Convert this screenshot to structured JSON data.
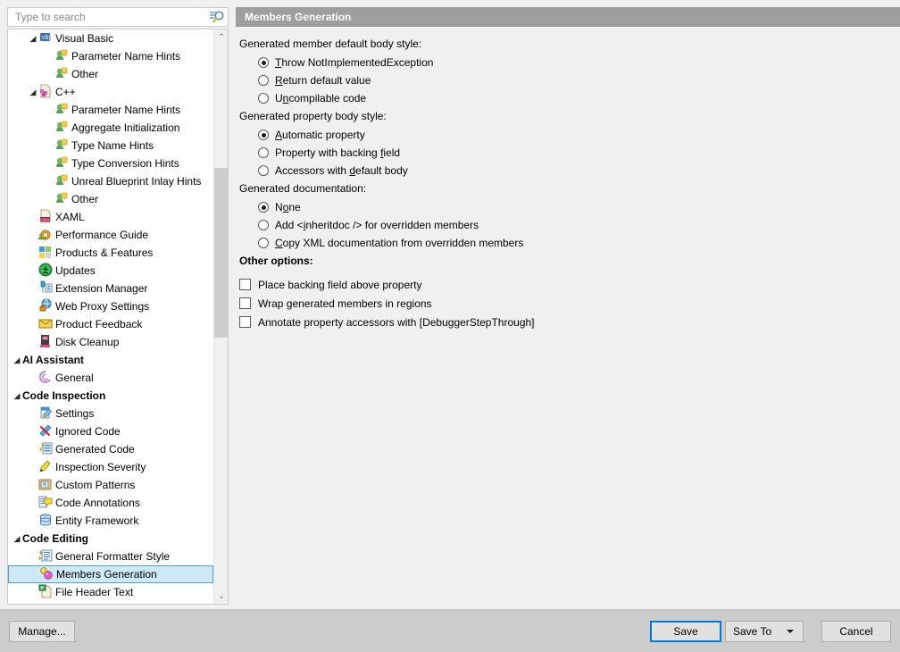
{
  "window": {
    "search": {
      "placeholder": "Type to search",
      "value": ""
    }
  },
  "tree": {
    "items": [
      {
        "label": "Visual Basic",
        "level": 1,
        "twisty": "◢",
        "icon": "visual-basic-icon",
        "group": false,
        "selected": false
      },
      {
        "label": "Parameter Name Hints",
        "level": 2,
        "twisty": "",
        "icon": "inlay-hints-icon",
        "group": false,
        "selected": false
      },
      {
        "label": "Other",
        "level": 2,
        "twisty": "",
        "icon": "inlay-hints-icon",
        "group": false,
        "selected": false
      },
      {
        "label": "C++",
        "level": 1,
        "twisty": "◢",
        "icon": "cpp-icon",
        "group": false,
        "selected": false
      },
      {
        "label": "Parameter Name Hints",
        "level": 2,
        "twisty": "",
        "icon": "inlay-hints-icon",
        "group": false,
        "selected": false
      },
      {
        "label": "Aggregate Initialization",
        "level": 2,
        "twisty": "",
        "icon": "inlay-hints-icon",
        "group": false,
        "selected": false
      },
      {
        "label": "Type Name Hints",
        "level": 2,
        "twisty": "",
        "icon": "inlay-hints-icon",
        "group": false,
        "selected": false
      },
      {
        "label": "Type Conversion Hints",
        "level": 2,
        "twisty": "",
        "icon": "inlay-hints-icon",
        "group": false,
        "selected": false
      },
      {
        "label": "Unreal Blueprint Inlay Hints",
        "level": 2,
        "twisty": "",
        "icon": "inlay-hints-icon",
        "group": false,
        "selected": false
      },
      {
        "label": "Other",
        "level": 2,
        "twisty": "",
        "icon": "inlay-hints-icon",
        "group": false,
        "selected": false
      },
      {
        "label": "XAML",
        "level": 1,
        "twisty": "",
        "icon": "xaml-icon",
        "group": false,
        "selected": false
      },
      {
        "label": "Performance Guide",
        "level": 1,
        "twisty": "",
        "icon": "snail-icon",
        "group": false,
        "selected": false
      },
      {
        "label": "Products & Features",
        "level": 1,
        "twisty": "",
        "icon": "products-features-icon",
        "group": false,
        "selected": false
      },
      {
        "label": "Updates",
        "level": 1,
        "twisty": "",
        "icon": "updates-icon",
        "group": false,
        "selected": false
      },
      {
        "label": "Extension Manager",
        "level": 1,
        "twisty": "",
        "icon": "extension-manager-icon",
        "group": false,
        "selected": false
      },
      {
        "label": "Web Proxy Settings",
        "level": 1,
        "twisty": "",
        "icon": "web-proxy-icon",
        "group": false,
        "selected": false
      },
      {
        "label": "Product Feedback",
        "level": 1,
        "twisty": "",
        "icon": "envelope-icon",
        "group": false,
        "selected": false
      },
      {
        "label": "Disk Cleanup",
        "level": 1,
        "twisty": "",
        "icon": "disk-cleanup-icon",
        "group": false,
        "selected": false
      },
      {
        "label": "AI Assistant",
        "level": 0,
        "twisty": "◢",
        "icon": "",
        "group": true,
        "selected": false
      },
      {
        "label": "General",
        "level": 1,
        "twisty": "",
        "icon": "ai-general-icon",
        "group": false,
        "selected": false
      },
      {
        "label": "Code Inspection",
        "level": 0,
        "twisty": "◢",
        "icon": "",
        "group": true,
        "selected": false
      },
      {
        "label": "Settings",
        "level": 1,
        "twisty": "",
        "icon": "settings-icon",
        "group": false,
        "selected": false
      },
      {
        "label": "Ignored Code",
        "level": 1,
        "twisty": "",
        "icon": "ignored-code-icon",
        "group": false,
        "selected": false
      },
      {
        "label": "Generated Code",
        "level": 1,
        "twisty": "",
        "icon": "generated-code-icon",
        "group": false,
        "selected": false
      },
      {
        "label": "Inspection Severity",
        "level": 1,
        "twisty": "",
        "icon": "inspection-severity-icon",
        "group": false,
        "selected": false
      },
      {
        "label": "Custom Patterns",
        "level": 1,
        "twisty": "",
        "icon": "custom-patterns-icon",
        "group": false,
        "selected": false
      },
      {
        "label": "Code Annotations",
        "level": 1,
        "twisty": "",
        "icon": "code-annotations-icon",
        "group": false,
        "selected": false
      },
      {
        "label": "Entity Framework",
        "level": 1,
        "twisty": "",
        "icon": "entity-framework-icon",
        "group": false,
        "selected": false
      },
      {
        "label": "Code Editing",
        "level": 0,
        "twisty": "◢",
        "icon": "",
        "group": true,
        "selected": false
      },
      {
        "label": "General Formatter Style",
        "level": 1,
        "twisty": "",
        "icon": "formatter-style-icon",
        "group": false,
        "selected": false
      },
      {
        "label": "Members Generation",
        "level": 1,
        "twisty": "",
        "icon": "members-generation-icon",
        "group": false,
        "selected": true
      },
      {
        "label": "File Header Text",
        "level": 1,
        "twisty": "",
        "icon": "file-header-icon",
        "group": false,
        "selected": false
      }
    ],
    "scrollbar": {
      "up_arrow": "⌃",
      "down_arrow": "⌄"
    }
  },
  "panel": {
    "title": "Members Generation",
    "groups": [
      {
        "label": "Generated member default body style:",
        "bold": false,
        "type": "radio",
        "options": [
          {
            "pre": "",
            "acc": "T",
            "post": "hrow NotImplementedException",
            "checked": true
          },
          {
            "pre": "",
            "acc": "R",
            "post": "eturn default value",
            "checked": false
          },
          {
            "pre": "U",
            "acc": "n",
            "post": "compilable code",
            "checked": false
          }
        ]
      },
      {
        "label": "Generated property body style:",
        "bold": false,
        "type": "radio",
        "options": [
          {
            "pre": "",
            "acc": "A",
            "post": "utomatic property",
            "checked": true
          },
          {
            "pre": "Property with backing ",
            "acc": "f",
            "post": "ield",
            "checked": false
          },
          {
            "pre": "Accessors with ",
            "acc": "d",
            "post": "efault body",
            "checked": false
          }
        ]
      },
      {
        "label": "Generated documentation:",
        "bold": false,
        "type": "radio",
        "options": [
          {
            "pre": "N",
            "acc": "o",
            "post": "ne",
            "checked": true
          },
          {
            "pre": "Add <",
            "acc": "i",
            "post": "nheritdoc /> for overridden members",
            "checked": false
          },
          {
            "pre": "",
            "acc": "C",
            "post": "opy XML documentation from overridden members",
            "checked": false
          }
        ]
      },
      {
        "label": "Other options:",
        "bold": true,
        "type": "checkbox",
        "options": [
          {
            "pre": "Place backing field above property",
            "acc": "",
            "post": "",
            "checked": false
          },
          {
            "pre": "Wrap generated members in regions",
            "acc": "",
            "post": "",
            "checked": false
          },
          {
            "pre": "Annotate property accessors with [DebuggerStepThrough]",
            "acc": "",
            "post": "",
            "checked": false
          }
        ]
      }
    ]
  },
  "footer": {
    "manage_label": "Manage...",
    "save_label": "Save",
    "save_to_label": "Save To",
    "cancel_label": "Cancel"
  },
  "colors": {
    "accent": "#0078d7",
    "selection_bg": "#cde8f6",
    "selection_border": "#4d9fd4",
    "header_bg": "#9e9e9e",
    "chrome": "#f0f0f0",
    "footer_bg": "#cccccc"
  }
}
